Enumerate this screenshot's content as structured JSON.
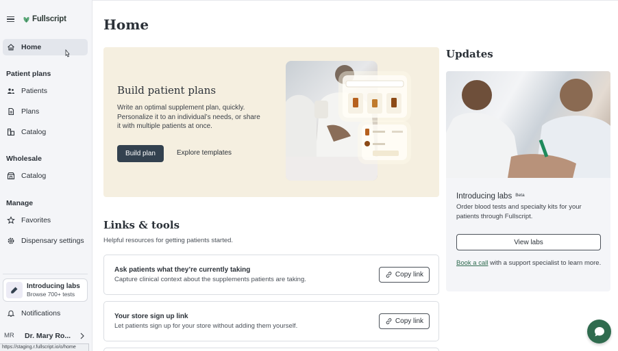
{
  "sidebar": {
    "brand": "Fullscript",
    "home": "Home",
    "sections": {
      "patient_plans": "Patient plans",
      "wholesale": "Wholesale",
      "manage": "Manage"
    },
    "items": {
      "patients": "Patients",
      "plans": "Plans",
      "catalog": "Catalog",
      "wholesale_catalog": "Catalog",
      "favorites": "Favorites",
      "dispensary_settings": "Dispensary settings",
      "notifications": "Notifications"
    },
    "promo": {
      "title": "Introducing labs",
      "subtitle": "Browse 700+ tests"
    },
    "user": {
      "initials": "MR",
      "name": "Dr. Mary Ro..."
    },
    "status_url": "https://staging.r.fullscript.io/o/home"
  },
  "main": {
    "title": "Home",
    "hero": {
      "title": "Build patient plans",
      "description": "Write an optimal supplement plan, quickly. Personalize it to an individual’s needs, or share it with multiple patients at once.",
      "primary_button": "Build plan",
      "secondary_button": "Explore templates"
    },
    "links": {
      "title": "Links & tools",
      "subtitle": "Helpful resources for getting patients started.",
      "cards": [
        {
          "title": "Ask patients what they’re currently taking",
          "description": "Capture clinical context about the supplements patients are taking.",
          "button": "Copy link"
        },
        {
          "title": "Your store sign up link",
          "description": "Let patients sign up for your store without adding them yourself.",
          "button": "Copy link"
        }
      ]
    }
  },
  "updates": {
    "title": "Updates",
    "card": {
      "heading": "Introducing labs",
      "badge": "Beta",
      "description": "Order blood tests and specialty kits for your patients through Fullscript.",
      "button": "View labs",
      "link_text": "Book a call",
      "footer_text": " with a support specialist to learn more."
    }
  },
  "colors": {
    "brand_green": "#2f6b4e",
    "primary_button": "#33414f",
    "hero_bg": "#f5efe0"
  }
}
